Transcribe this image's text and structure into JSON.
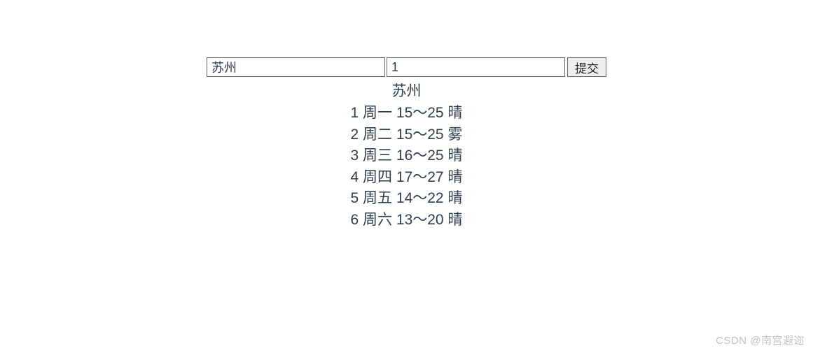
{
  "form": {
    "city_value": "苏州",
    "second_value": "1",
    "submit_label": "提交"
  },
  "result": {
    "city": "苏州",
    "forecast": [
      {
        "idx": "1",
        "day": "周一",
        "range": "15～25",
        "cond": "晴"
      },
      {
        "idx": "2",
        "day": "周二",
        "range": "15～25",
        "cond": "雾"
      },
      {
        "idx": "3",
        "day": "周三",
        "range": "16～25",
        "cond": "晴"
      },
      {
        "idx": "4",
        "day": "周四",
        "range": "17～27",
        "cond": "晴"
      },
      {
        "idx": "5",
        "day": "周五",
        "range": "14～22",
        "cond": "晴"
      },
      {
        "idx": "6",
        "day": "周六",
        "range": "13～20",
        "cond": "晴"
      }
    ]
  },
  "watermark": "CSDN @南宫遐迩"
}
